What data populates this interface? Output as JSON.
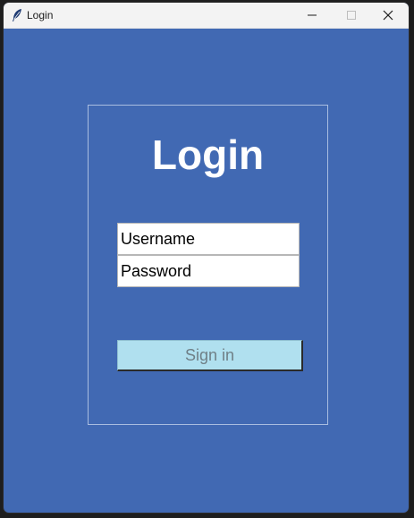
{
  "window": {
    "title": "Login",
    "icon": "feather-icon"
  },
  "controls": {
    "minimize_icon": "minimize-icon",
    "maximize_icon": "maximize-icon",
    "close_icon": "close-icon"
  },
  "form": {
    "heading": "Login",
    "username_placeholder": "Username",
    "password_placeholder": "Password",
    "signin_label": "Sign in"
  },
  "colors": {
    "background": "#4169b3",
    "button": "#b0e0ef",
    "heading_text": "#ffffff"
  }
}
